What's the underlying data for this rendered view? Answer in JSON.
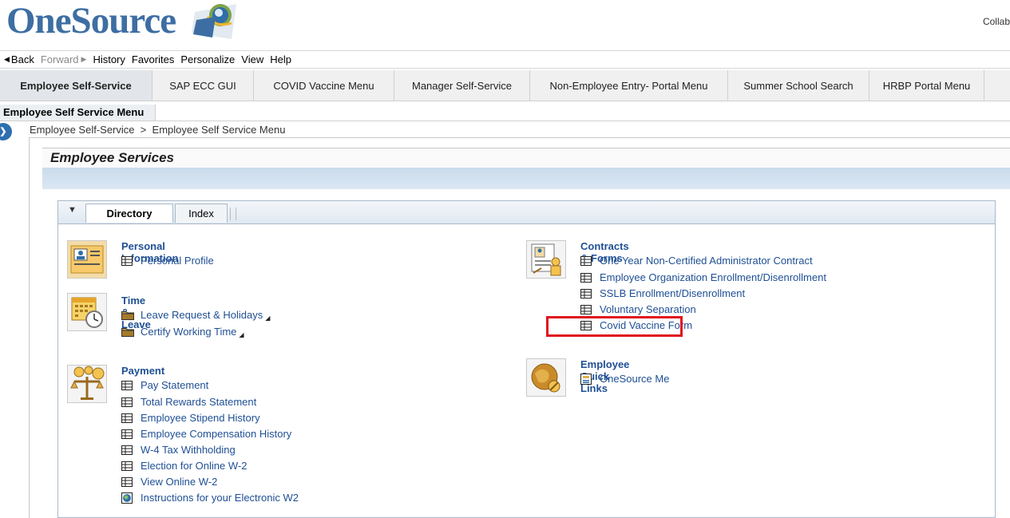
{
  "header": {
    "logo": "OneSource",
    "top_right": "Collab"
  },
  "history_bar": {
    "back": "Back",
    "forward": "Forward",
    "history": "History",
    "favorites": "Favorites",
    "personalize": "Personalize",
    "view": "View",
    "help": "Help"
  },
  "top_tabs": [
    {
      "label": "Employee Self-Service",
      "active": true
    },
    {
      "label": "SAP ECC GUI"
    },
    {
      "label": "COVID Vaccine Menu"
    },
    {
      "label": "Manager Self-Service"
    },
    {
      "label": "Non-Employee Entry- Portal Menu"
    },
    {
      "label": "Summer School Search"
    },
    {
      "label": "HRBP Portal Menu"
    }
  ],
  "subnav": {
    "item": "Employee Self Service Menu"
  },
  "breadcrumb": {
    "text": "Employee Self-Service  >  Employee Self Service Menu"
  },
  "page": {
    "title": "Employee Services"
  },
  "panel_tabs": {
    "directory": "Directory",
    "index": "Index"
  },
  "groups": {
    "personal": {
      "title": "Personal Information",
      "links": [
        "Personal Profile"
      ]
    },
    "time": {
      "title": "Time & Leave",
      "links": [
        "Leave Request & Holidays",
        "Certify Working Time"
      ]
    },
    "payment": {
      "title": "Payment",
      "links": [
        "Pay Statement",
        "Total Rewards Statement",
        "Employee Stipend History",
        "Employee Compensation History",
        "W-4 Tax Withholding",
        "Election for Online W-2",
        "View Online W-2",
        "Instructions for your Electronic W2"
      ]
    },
    "contracts": {
      "title": "Contracts & Forms",
      "links": [
        "One Year Non-Certified Administrator Contract",
        "Employee Organization Enrollment/Disenrollment",
        "SSLB Enrollment/Disenrollment",
        "Voluntary Separation",
        "Covid Vaccine Form"
      ]
    },
    "quick": {
      "title": "Employee Quick Links",
      "links": [
        "OneSource Me"
      ]
    }
  },
  "colors": {
    "accent": "#1f4f94",
    "highlight": "#e0151e",
    "logo": "#3d6ea3"
  }
}
